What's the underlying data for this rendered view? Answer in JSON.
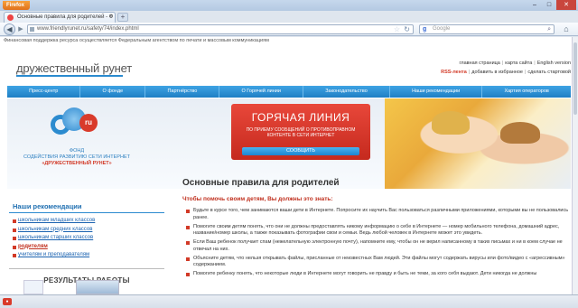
{
  "browser": {
    "app_button": "Firefox",
    "tab_title": "Основные правила для родителей - Ф",
    "tab_close": "×",
    "newtab_label": "+",
    "url": "www.friendlyrunet.ru/safety/74/index.phtml",
    "search_placeholder": "Google",
    "window_controls": [
      "–",
      "□",
      "✕"
    ]
  },
  "page": {
    "top_note": "Финансовая поддержка ресурса осуществляется Федеральным агентством по печати и массовым коммуникациям",
    "logo": "дружественный рунет",
    "toplinks": {
      "home": "главная страница",
      "sitemap": "карта сайта",
      "english": "English version",
      "rss": "RSS-лента",
      "favorites": "добавить в избранное",
      "make_start": "сделать стартовой"
    },
    "menu": [
      "Пресс-центр",
      "О фонде",
      "Партнёрство",
      "О Горячей линии",
      "Законодательство",
      "Наши рекомендации",
      "Хартия операторов"
    ],
    "banner": {
      "fund_badge": "ru",
      "fund_line1": "ФОНД",
      "fund_line2": "СОДЕЙСТВИЯ РАЗВИТИЮ СЕТИ ИНТЕРНЕТ",
      "fund_line3": "«ДРУЖЕСТВЕННЫЙ РУНЕТ»",
      "hotline_title": "ГОРЯЧАЯ ЛИНИЯ",
      "hotline_sub": "ПО ПРИЕМУ СООБЩЕНИЙ О ПРОТИВОПРАВНОМ КОНТЕНТЕ В СЕТИ ИНТЕРНЕТ",
      "hotline_button": "СООБЩИТЬ"
    },
    "sidebar": {
      "heading": "Наши рекомендации",
      "items": [
        "школьникам младших классов",
        "школьникам средних классов",
        "школьникам старших классов",
        "родителям",
        "учителям и преподавателям"
      ],
      "results_heading": "РЕЗУЛЬТАТЫ РАБОТЫ"
    },
    "article": {
      "title": "Основные правила для родителей",
      "intro": "Чтобы помочь своим детям, Вы должны это знать:",
      "paragraphs": [
        "Будьте в курсе того, чем занимаются ваши дети в Интернете. Попросите их научить Вас пользоваться различными приложениями, которыми вы не пользовались ранее.",
        "Помогите своим детям понять, что они не должны предоставлять никому информацию о себе в Интернете — номер мобильного телефона, домашний адрес, название/номер школы, а также показывать фотографии свои и семьи. Ведь любой человек в Интернете может это увидеть.",
        "Если Ваш ребенок получает спам (нежелательную электронную почту), напомните ему, чтобы он не верил написанному в таких письмах и ни в коем случае не отвечал на них.",
        "Объясните детям, что нельзя открывать файлы, присланные от неизвестных Вам людей. Эти файлы могут содержать вирусы или фото/видео с «агрессивным» содержанием.",
        "Помогите ребенку понять, что некоторые люди в Интернете могут говорить не правду и быть не теми, за кого себя выдают. Дети никогда не должны"
      ]
    }
  },
  "colors": {
    "accent": "#2b8bcf",
    "red": "#d23a27",
    "link": "#1a62b0"
  }
}
